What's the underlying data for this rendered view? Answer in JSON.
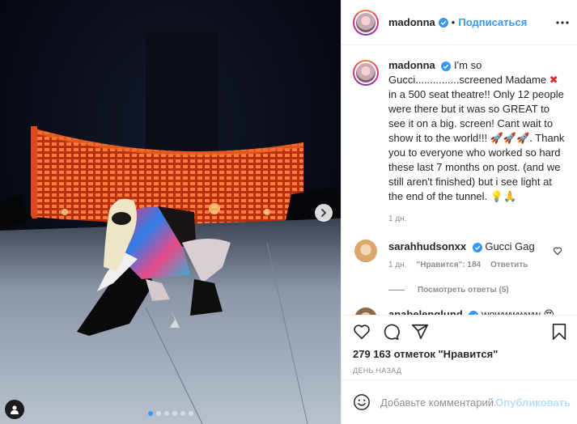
{
  "post": {
    "username": "madonna",
    "follow_label": "Подписаться",
    "separator": "•",
    "caption": {
      "part1": "I'm so Gucci...............screened Madame",
      "emoji_x": "✖",
      "part2": "in a 500 seat theatre!! Only 12 people were there but it was so GREAT to see it on a big. screen! Cant wait to show it to the world!!!",
      "rockets": "🚀🚀🚀",
      "part3": ". Thank you to everyone who worked so hard these last 7 months on post. (and we still aren't finished) but i see light at the end of the tunnel.",
      "emoji_end": "💡🙏",
      "time": "1 дн."
    },
    "comments": [
      {
        "username": "sarahhudsonxx",
        "text": "Gucci Gag",
        "time": "1 дн.",
        "likes": "\"Нравится\": 184",
        "reply_label": "Ответить",
        "view_replies": "Посмотреть ответы (5)"
      },
      {
        "username": "anabelenglund",
        "text": "wowwwwww 😍"
      }
    ],
    "likes_text": "279 163 отметок \"Нравится\"",
    "date_text": "ДЕНЬ НАЗАД",
    "comment_placeholder": "Добавьте комментарий...",
    "publish_label": "Опубликовать",
    "carousel": {
      "count": 6,
      "active_index": 0
    }
  },
  "colors": {
    "accent": "#3897f0",
    "text": "#262626",
    "muted": "#8e8e8e",
    "publish_disabled": "#b2dffc"
  },
  "icons": [
    "verified-badge-icon",
    "more-options-icon",
    "heart-icon",
    "comment-icon",
    "share-icon",
    "bookmark-icon",
    "chevron-right-icon",
    "user-tag-icon"
  ]
}
